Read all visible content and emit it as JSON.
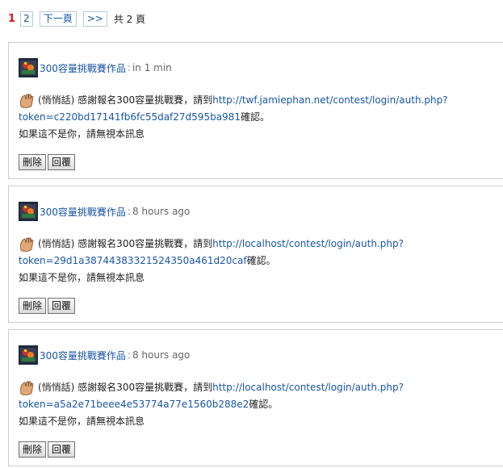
{
  "pagination": {
    "current": "1",
    "page_2": "2",
    "next": "下一頁",
    "last": ">>",
    "total": "共 2 頁"
  },
  "messages": [
    {
      "sender": "300容量挑戰賽作品",
      "separator": ":",
      "time": "in 1 min",
      "prefix": "(悄悄話) 感謝報名300容量挑戰賽，請到",
      "link_line1": "http://twf.jamiephan.net/contest/login/auth.php?",
      "link_line2": "token=c220bd17141fb6fc55daf27d595ba981",
      "suffix": " 確認。",
      "note": "如果這不是你，請無視本訊息",
      "delete_label": "刪除",
      "reply_label": "回覆"
    },
    {
      "sender": "300容量挑戰賽作品",
      "separator": ":",
      "time": "8 hours ago",
      "prefix": "(悄悄話) 感謝報名300容量挑戰賽，請到",
      "link_line1": "http://localhost/contest/login/auth.php?",
      "link_line2": "token=29d1a38744383321524350a461d20caf",
      "suffix": " 確認。",
      "note": "如果這不是你，請無視本訊息",
      "delete_label": "刪除",
      "reply_label": "回覆"
    },
    {
      "sender": "300容量挑戰賽作品",
      "separator": ":",
      "time": "8 hours ago",
      "prefix": "(悄悄話) 感謝報名300容量挑戰賽，請到",
      "link_line1": "http://localhost/contest/login/auth.php?",
      "link_line2": "token=a5a2e71beee4e53774a77e1560b288e2",
      "suffix": " 確認。",
      "note": "如果這不是你，請無視本訊息",
      "delete_label": "刪除",
      "reply_label": "回覆"
    }
  ],
  "icons": {
    "avatar": "avatar-image",
    "whisper": "whisper-hand-icon"
  },
  "colors": {
    "link": "#1a56a8",
    "current_page": "#e8121c",
    "border": "#cccccc"
  }
}
